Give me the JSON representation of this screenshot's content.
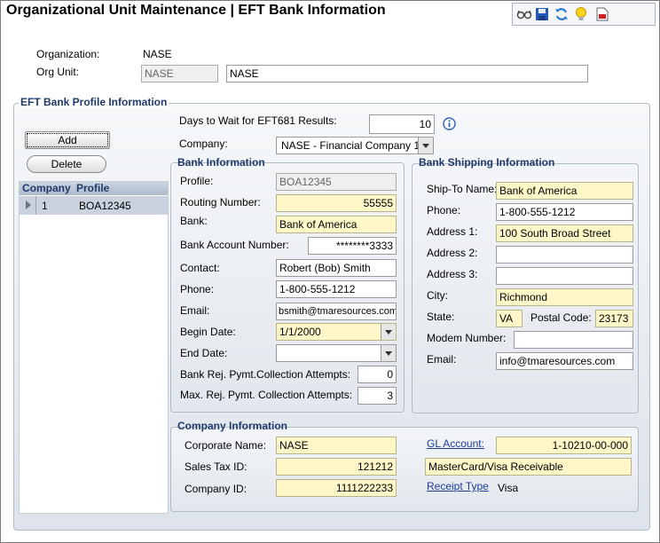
{
  "header": {
    "title": "Organizational Unit Maintenance | EFT Bank Information",
    "toolbar_icons": [
      "glasses-icon",
      "save-icon",
      "refresh-icon",
      "lightbulb-icon",
      "report-icon"
    ]
  },
  "org": {
    "organization_label": "Organization:",
    "organization_value": "NASE",
    "org_unit_label": "Org Unit:",
    "org_unit_code": "NASE",
    "org_unit_name": "NASE"
  },
  "profile_section": {
    "legend": "EFT Bank Profile Information",
    "add_label": "Add",
    "delete_label": "Delete",
    "list": {
      "columns": [
        "Company",
        "Profile"
      ],
      "rows": [
        {
          "company": "1",
          "profile": "BOA12345"
        }
      ]
    },
    "days_wait_label": "Days to Wait for EFT681 Results:",
    "days_wait_value": "10",
    "company_label": "Company:",
    "company_value": "NASE - Financial Company 1"
  },
  "bank_info": {
    "legend": "Bank Information",
    "profile_label": "Profile:",
    "profile_value": "BOA12345",
    "routing_label": "Routing Number:",
    "routing_value": "55555",
    "bank_label": "Bank:",
    "bank_value": "Bank of America",
    "account_label": "Bank Account Number:",
    "account_value": "********3333",
    "contact_label": "Contact:",
    "contact_value": "Robert (Bob) Smith",
    "phone_label": "Phone:",
    "phone_value": "1-800-555-1212",
    "email_label": "Email:",
    "email_value": "bsmith@tmaresources.com",
    "begin_label": "Begin Date:",
    "begin_value": "1/1/2000",
    "end_label": "End Date:",
    "end_value": "",
    "rej_label": "Bank Rej. Pymt.Collection Attempts:",
    "rej_value": "0",
    "max_label": "Max. Rej. Pymt. Collection Attempts:",
    "max_value": "3"
  },
  "shipping": {
    "legend": "Bank Shipping Information",
    "shipto_label": "Ship-To Name:",
    "shipto_value": "Bank of America",
    "phone_label": "Phone:",
    "phone_value": "1-800-555-1212",
    "addr1_label": "Address 1:",
    "addr1_value": "100 South Broad Street",
    "addr2_label": "Address 2:",
    "addr2_value": "",
    "addr3_label": "Address 3:",
    "addr3_value": "",
    "city_label": "City:",
    "city_value": "Richmond",
    "state_label": "State:",
    "state_value": "VA",
    "postal_label": "Postal Code:",
    "postal_value": "23173",
    "modem_label": "Modem Number:",
    "modem_value": "",
    "email_label": "Email:",
    "email_value": "info@tmaresources.com"
  },
  "company_info": {
    "legend": "Company Information",
    "corp_label": "Corporate Name:",
    "corp_value": "NASE",
    "tax_label": "Sales Tax ID:",
    "tax_value": "121212",
    "cid_label": "Company ID:",
    "cid_value": "1111222233",
    "gl_label": "GL Account:",
    "gl_value": "1-10210-00-000",
    "gl_desc": "MasterCard/Visa Receivable",
    "receipt_label": "Receipt Type",
    "receipt_value": "Visa"
  },
  "colors": {
    "accent": "#1f3a6a",
    "required_field": "#fff7c8",
    "link": "#1a3d99"
  }
}
